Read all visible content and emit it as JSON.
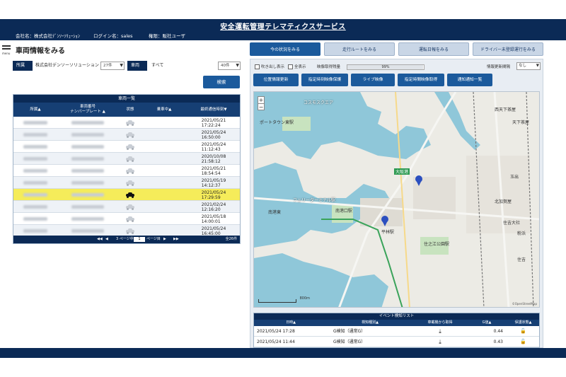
{
  "header": {
    "title": "安全運転管理テレマティクスサービス",
    "company": "会社名：株式会社ﾃﾞﾝｿｰｿﾘｭｰｼｮﾝ",
    "login": "ログイン名：sales",
    "role": "権限：販社ユーザ"
  },
  "left": {
    "menu_label": "menu",
    "page_title": "車両情報をみる",
    "filter": {
      "area_label": "所属",
      "area_value": "株式会社デンソーソリューション 本社",
      "area_count": "27件",
      "vehicle_label": "車両",
      "vehicle_value": "すべて",
      "vehicle_count": "40件"
    },
    "search_button": "検索",
    "table": {
      "title": "車両一覧",
      "headers": {
        "affiliation": "所属▲",
        "plate_line1": "車両番号",
        "plate_line2": "ナンバープレート ▲",
        "status": "状態",
        "driver": "乗車中▲",
        "last_comm": "最終通信時刻▼"
      },
      "rows": [
        {
          "date": "2021/05/21",
          "time": "17:22:24",
          "active": false
        },
        {
          "date": "2021/05/24",
          "time": "16:50:00",
          "active": false
        },
        {
          "date": "2021/05/24",
          "time": "11:12:43",
          "active": false
        },
        {
          "date": "2020/10/08",
          "time": "21:58:12",
          "active": false
        },
        {
          "date": "2021/05/21",
          "time": "18:54:54",
          "active": false
        },
        {
          "date": "2021/05/19",
          "time": "14:12:37",
          "active": false
        },
        {
          "date": "2021/05/24",
          "time": "17:29:59",
          "active": true
        },
        {
          "date": "2021/02/24",
          "time": "12:16:20",
          "active": false
        },
        {
          "date": "2021/05/18",
          "time": "14:00:01",
          "active": false
        },
        {
          "date": "2021/05/24",
          "time": "16:45:00",
          "active": false
        }
      ]
    },
    "pager": {
      "first": "◀◀",
      "prev": "◀",
      "text1": "3 ページ中",
      "current": "1",
      "text2": "ページ目",
      "next": "▶▶",
      "last": "▶",
      "total": "全26件"
    }
  },
  "tabs": [
    {
      "label": "今の状況をみる",
      "active": true
    },
    {
      "label": "走行ルートをみる",
      "active": false
    },
    {
      "label": "運転日報をみる",
      "active": false
    },
    {
      "label": "ドライバー未登録運行をみる",
      "active": false
    }
  ],
  "right": {
    "options": {
      "balloon_label": "吹き出し表示",
      "show_all_label": "全表示",
      "video_status_label": "映像取得残量",
      "progress_text": "99%",
      "progress_value": 0.99,
      "interval_label": "情報更新間隔",
      "interval_value": "なし"
    },
    "buttons": [
      "位置情報更新",
      "指定時刻映像保護",
      "ライブ映像",
      "指定時間映像取得",
      "通知通知一覧"
    ],
    "map": {
      "labels": {
        "l1": "ポートタウン東駅",
        "l2": "南港東",
        "l3": "フェリーターミナル駅",
        "l4": "南港口駅",
        "l5": "平林駅",
        "l6": "住之江公園駅",
        "l7": "西天下茶屋",
        "l8": "天下茶屋",
        "l9": "玉出",
        "l10": "北加賀屋",
        "l11": "粉浜",
        "l12": "住吉大社",
        "l13": "住吉",
        "l14": "大阪港",
        "l15": "コスモスクエア"
      },
      "zoom_in": "+",
      "zoom_out": "−",
      "scale": "800m",
      "attribution": "©OpenStreetMap"
    },
    "events": {
      "title": "イベント検知リスト",
      "headers": [
        "日時▲",
        "検知種別▲",
        "車載機から取得",
        "G値▲",
        "保護状態▲"
      ],
      "rows": [
        {
          "datetime": "2021/05/24 17:28",
          "type": "G検知（通常G）",
          "g": "0.44"
        },
        {
          "datetime": "2021/05/24 11:44",
          "type": "G検知（通常G）",
          "g": "0.43"
        }
      ]
    }
  },
  "colors": {
    "navy": "#0b2a56",
    "accent": "#1b5a9c",
    "highlight": "#f5ec5a",
    "water": "#8fc7d9"
  },
  "icons": {
    "menu": "hamburger-icon",
    "car": "car-icon",
    "download": "download-icon",
    "lock": "lock-icon",
    "pin": "map-pin-icon"
  }
}
